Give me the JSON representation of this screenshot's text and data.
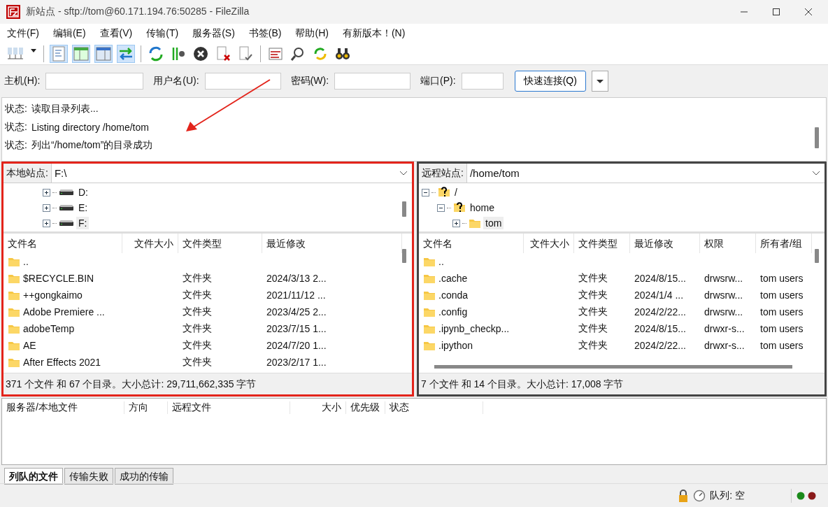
{
  "window": {
    "title": "新站点 - sftp://tom@60.171.194.76:50285 - FileZilla"
  },
  "menu": [
    "文件(F)",
    "编辑(E)",
    "查看(V)",
    "传输(T)",
    "服务器(S)",
    "书签(B)",
    "帮助(H)",
    "有新版本！(N)"
  ],
  "quickconnect": {
    "fields": [
      {
        "label": "主机(H):"
      },
      {
        "label": "用户名(U):"
      },
      {
        "label": "密码(W):"
      },
      {
        "label": "端口(P):"
      }
    ],
    "button": "快速连接(Q)"
  },
  "log": [
    {
      "label": "状态:",
      "text": "读取目录列表..."
    },
    {
      "label": "状态:",
      "text": "Listing directory /home/tom"
    },
    {
      "label": "状态:",
      "text": "列出“/home/tom”的目录成功"
    }
  ],
  "local": {
    "label": "本地站点:",
    "path": "F:\\",
    "tree": [
      {
        "name": "D:",
        "expanded": false,
        "selected": false
      },
      {
        "name": "E:",
        "expanded": false,
        "selected": false
      },
      {
        "name": "F:",
        "expanded": false,
        "selected": true
      }
    ],
    "columns": [
      "文件名",
      "文件大小",
      "文件类型",
      "最近修改"
    ],
    "rows": [
      {
        "name": ".."
      },
      {
        "name": "$RECYCLE.BIN",
        "type": "文件夹",
        "modified": "2024/3/13 2..."
      },
      {
        "name": "++gongkaimo",
        "type": "文件夹",
        "modified": "2021/11/12 ..."
      },
      {
        "name": "Adobe Premiere ...",
        "type": "文件夹",
        "modified": "2023/4/25 2..."
      },
      {
        "name": "adobeTemp",
        "type": "文件夹",
        "modified": "2023/7/15 1..."
      },
      {
        "name": "AE",
        "type": "文件夹",
        "modified": "2024/7/20 1..."
      },
      {
        "name": "After Effects 2021",
        "type": "文件夹",
        "modified": "2023/2/17 1..."
      }
    ],
    "summary": "371 个文件 和 67 个目录。大小总计: 29,711,662,335 字节"
  },
  "remote": {
    "label": "远程站点:",
    "path": "/home/tom",
    "tree": [
      {
        "name": "/",
        "expanded": true,
        "selected": false,
        "children": [
          {
            "name": "home",
            "expanded": true,
            "selected": false,
            "children": [
              {
                "name": "tom",
                "expanded": false,
                "selected": true
              }
            ]
          }
        ]
      }
    ],
    "columns": [
      "文件名",
      "文件大小",
      "文件类型",
      "最近修改",
      "权限",
      "所有者/组"
    ],
    "rows": [
      {
        "name": ".."
      },
      {
        "name": ".cache",
        "type": "文件夹",
        "modified": "2024/8/15...",
        "permissions": "drwsrw...",
        "owner": "tom users"
      },
      {
        "name": ".conda",
        "type": "文件夹",
        "modified": "2024/1/4 ...",
        "permissions": "drwsrw...",
        "owner": "tom users"
      },
      {
        "name": ".config",
        "type": "文件夹",
        "modified": "2024/2/22...",
        "permissions": "drwsrw...",
        "owner": "tom users"
      },
      {
        "name": ".ipynb_checkp...",
        "type": "文件夹",
        "modified": "2024/8/15...",
        "permissions": "drwxr-s...",
        "owner": "tom users"
      },
      {
        "name": ".ipython",
        "type": "文件夹",
        "modified": "2024/2/22...",
        "permissions": "drwxr-s...",
        "owner": "tom users"
      }
    ],
    "summary": "7 个文件 和 14 个目录。大小总计: 17,008 字节"
  },
  "queue": {
    "columns": [
      "服务器/本地文件",
      "方向",
      "远程文件",
      "大小",
      "优先级",
      "状态"
    ]
  },
  "tabs": [
    {
      "label": "列队的文件",
      "selected": true
    },
    {
      "label": "传输失败",
      "selected": false
    },
    {
      "label": "成功的传输",
      "selected": false
    }
  ],
  "status_bar": {
    "queue": "队列: 空"
  }
}
